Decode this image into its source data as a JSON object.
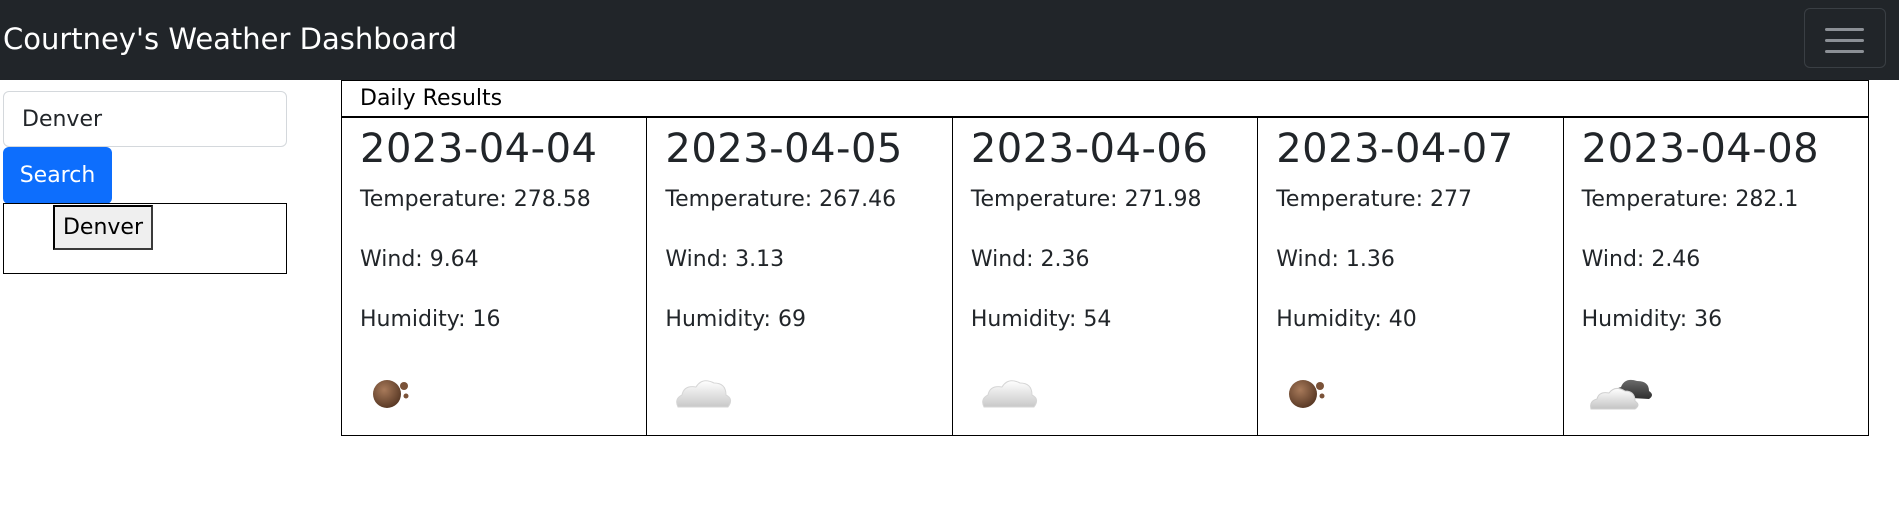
{
  "header": {
    "title": "Courtney's Weather Dashboard",
    "menu_icon": "hamburger-menu-icon"
  },
  "search": {
    "value": "Denver",
    "button_label": "Search"
  },
  "history": {
    "items": [
      "Denver"
    ]
  },
  "results": {
    "heading": "Daily Results",
    "days": [
      {
        "date": "2023-04-04",
        "temperature": "Temperature: 278.58",
        "wind": "Wind: 9.64",
        "humidity": "Humidity: 16",
        "icon": "haze-icon"
      },
      {
        "date": "2023-04-05",
        "temperature": "Temperature: 267.46",
        "wind": "Wind: 3.13",
        "humidity": "Humidity: 69",
        "icon": "cloud-icon"
      },
      {
        "date": "2023-04-06",
        "temperature": "Temperature: 271.98",
        "wind": "Wind: 2.36",
        "humidity": "Humidity: 54",
        "icon": "cloud-icon"
      },
      {
        "date": "2023-04-07",
        "temperature": "Temperature: 277",
        "wind": "Wind: 1.36",
        "humidity": "Humidity: 40",
        "icon": "haze-icon"
      },
      {
        "date": "2023-04-08",
        "temperature": "Temperature: 282.1",
        "wind": "Wind: 2.46",
        "humidity": "Humidity: 36",
        "icon": "broken-clouds-icon"
      }
    ]
  },
  "colors": {
    "navbar_bg": "#212529",
    "primary_button": "#0d6efd"
  }
}
